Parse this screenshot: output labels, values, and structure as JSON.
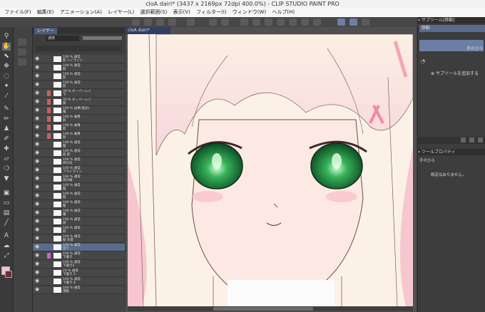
{
  "title": "cloA dairi* (3437 x 2169px 72dpi 400.0%) - CLIP STUDIO PAINT PRO",
  "menu": [
    "ファイル(F)",
    "編集(E)",
    "アニメーション(A)",
    "レイヤー(L)",
    "選択範囲(S)",
    "表示(V)",
    "フィルター(I)",
    "ウィンドウ(W)",
    "ヘルプ(H)"
  ],
  "layer_panel": {
    "tab": "レイヤー",
    "blend_mode": "通常",
    "layers": [
      {
        "name": "100 % 通常\n影 ハイライト",
        "swatch": ""
      },
      {
        "name": "100 % 通常\n影",
        "swatch": ""
      },
      {
        "name": "100 % 通常\n影",
        "swatch": ""
      },
      {
        "name": "100 % 通常\n影",
        "swatch": ""
      },
      {
        "name": "36 % オーバーレイ\n下",
        "swatch": "#c86060"
      },
      {
        "name": "30 % オーバーレイ\n紫",
        "swatch": "#c86060"
      },
      {
        "name": "100 % 加算(発光)\n瞳",
        "swatch": "#c86060"
      },
      {
        "name": "100 % 乗算\n影",
        "swatch": "#c86060"
      },
      {
        "name": "100 % 乗算\n影",
        "swatch": "#c86060"
      },
      {
        "name": "100 % 乗算\n影",
        "swatch": "#c86060"
      },
      {
        "name": "100 % 通常\n髪",
        "swatch": ""
      },
      {
        "name": "100 % 通常\n肌 影",
        "swatch": ""
      },
      {
        "name": "100 % 通常\n目の白",
        "swatch": ""
      },
      {
        "name": "100 % 通常\nアウトライン",
        "swatch": ""
      },
      {
        "name": "100 % 通常\n目の線",
        "swatch": ""
      },
      {
        "name": "100 % 通常\n髪",
        "swatch": ""
      },
      {
        "name": "100 % 通常\n肌",
        "swatch": ""
      },
      {
        "name": "100 % 通常\n髪",
        "swatch": ""
      },
      {
        "name": "100 % 通常\n瞳",
        "swatch": ""
      },
      {
        "name": "100 % 通常\n顔",
        "swatch": ""
      },
      {
        "name": "100 % 通常\n影",
        "swatch": ""
      },
      {
        "name": "100 % 通常\n髪 背景",
        "swatch": ""
      },
      {
        "name": "100 % 通常\n塗り",
        "swatch": "",
        "selected": true
      },
      {
        "name": "100 % 通常\n下書き",
        "swatch": "#d060d0"
      },
      {
        "name": "100 % 通常\n下書き2",
        "swatch": ""
      },
      {
        "name": "24 % 通常\n下書き 3",
        "swatch": ""
      },
      {
        "name": "100 % 通常\n下書き 4",
        "swatch": ""
      },
      {
        "name": "100 % 通常\n用紙",
        "swatch": ""
      }
    ]
  },
  "canvas": {
    "tab": "cloA dairi*"
  },
  "sub_tool": {
    "title": "サブツール[移動]",
    "item": "移動",
    "selected": "手のひら",
    "add_label": "サブツールを追加する"
  },
  "tool_property": {
    "title": "ツールプロパティ",
    "tool_name": "手のひら",
    "empty_label": "設定はありません。"
  },
  "colors": {
    "accent": "#5b6b8c",
    "main_color": "#f2c3c8",
    "sub_color": "#6b2d3a"
  }
}
